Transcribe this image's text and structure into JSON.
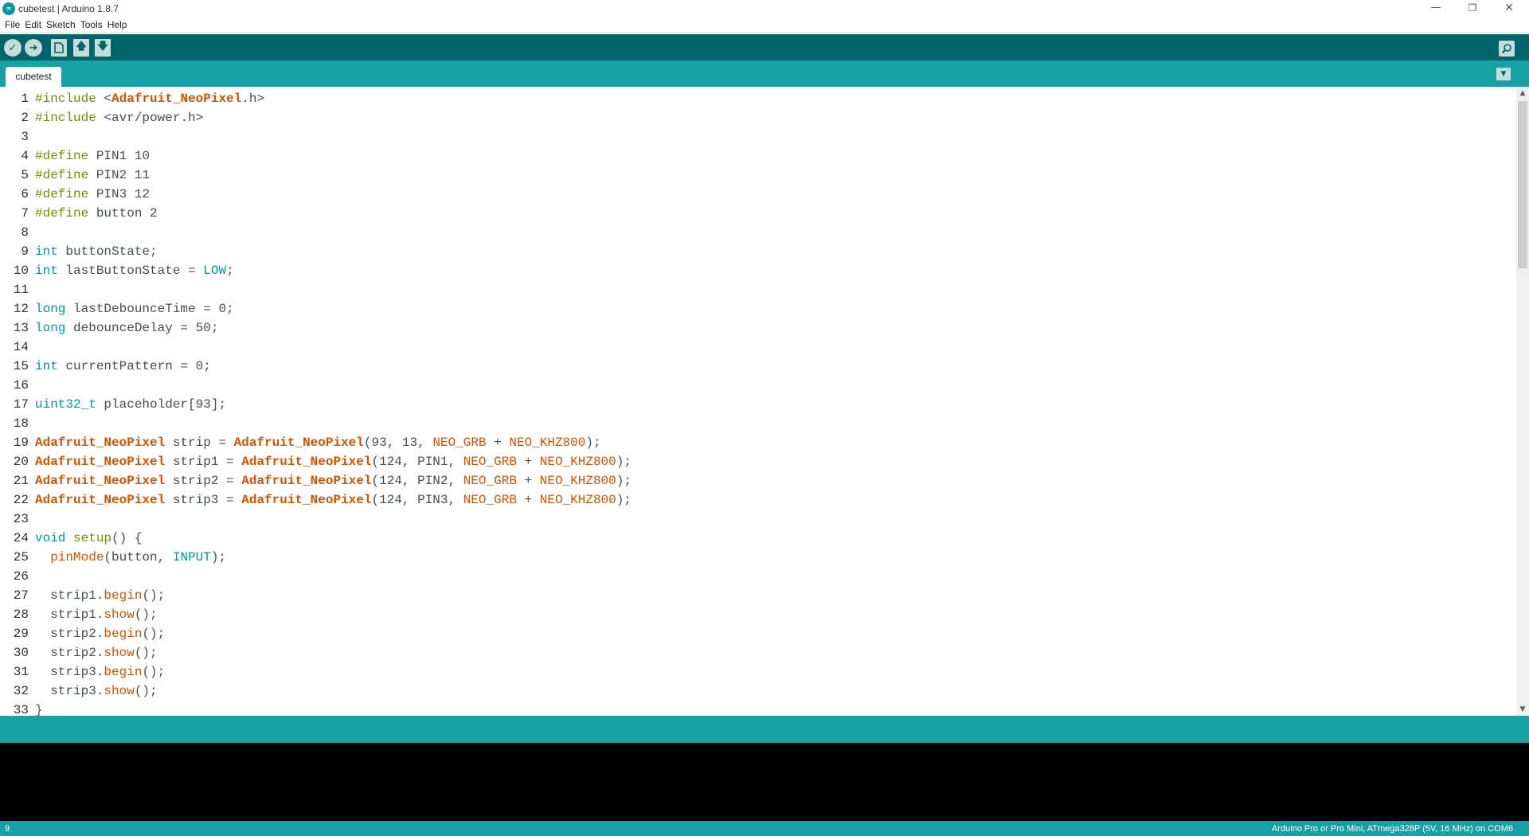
{
  "window": {
    "title": "cubetest | Arduino 1.8.7",
    "logo_text": "∞",
    "minimize": "—",
    "maximize": "❐",
    "close": "✕"
  },
  "menu": [
    "File",
    "Edit",
    "Sketch",
    "Tools",
    "Help"
  ],
  "toolbar": {
    "verify_icon": "check-icon",
    "upload_icon": "arrow-right-icon",
    "new_icon": "new-file-icon",
    "open_icon": "arrow-up-icon",
    "save_icon": "arrow-down-icon",
    "serial_monitor_icon": "magnifier-icon"
  },
  "tab": {
    "label": "cubetest",
    "menu_icon": "triangle-down-icon"
  },
  "code_lines": [
    [
      [
        "#include ",
        "kw"
      ],
      [
        "<",
        ""
      ],
      [
        "Adafruit_NeoPixel",
        "lib"
      ],
      [
        ".h>",
        ""
      ]
    ],
    [
      [
        "#include ",
        "kw"
      ],
      [
        "<avr/power.h>",
        ""
      ]
    ],
    [],
    [
      [
        "#define ",
        "kw"
      ],
      [
        "PIN1 10",
        ""
      ]
    ],
    [
      [
        "#define ",
        "kw"
      ],
      [
        "PIN2 11",
        ""
      ]
    ],
    [
      [
        "#define ",
        "kw"
      ],
      [
        "PIN3 12",
        ""
      ]
    ],
    [
      [
        "#define ",
        "kw"
      ],
      [
        "button 2",
        ""
      ]
    ],
    [],
    [
      [
        "int",
        "type"
      ],
      [
        " buttonState;",
        ""
      ]
    ],
    [
      [
        "int",
        "type"
      ],
      [
        " lastButtonState = ",
        ""
      ],
      [
        "LOW",
        "const"
      ],
      [
        ";",
        ""
      ]
    ],
    [],
    [
      [
        "long",
        "type"
      ],
      [
        " lastDebounceTime = 0;",
        ""
      ]
    ],
    [
      [
        "long",
        "type"
      ],
      [
        " debounceDelay = 50;",
        ""
      ]
    ],
    [],
    [
      [
        "int",
        "type"
      ],
      [
        " currentPattern = 0;",
        ""
      ]
    ],
    [],
    [
      [
        "uint32_t",
        "type"
      ],
      [
        " placeholder[93];",
        ""
      ]
    ],
    [],
    [
      [
        "Adafruit_NeoPixel",
        "lib"
      ],
      [
        " strip = ",
        ""
      ],
      [
        "Adafruit_NeoPixel",
        "lib"
      ],
      [
        "(93, 13, ",
        ""
      ],
      [
        "NEO_GRB",
        "neo"
      ],
      [
        " + ",
        ""
      ],
      [
        "NEO_KHZ800",
        "neo"
      ],
      [
        ");",
        ""
      ]
    ],
    [
      [
        "Adafruit_NeoPixel",
        "lib"
      ],
      [
        " strip1 = ",
        ""
      ],
      [
        "Adafruit_NeoPixel",
        "lib"
      ],
      [
        "(124, PIN1, ",
        ""
      ],
      [
        "NEO_GRB",
        "neo"
      ],
      [
        " + ",
        ""
      ],
      [
        "NEO_KHZ800",
        "neo"
      ],
      [
        ");",
        ""
      ]
    ],
    [
      [
        "Adafruit_NeoPixel",
        "lib"
      ],
      [
        " strip2 = ",
        ""
      ],
      [
        "Adafruit_NeoPixel",
        "lib"
      ],
      [
        "(124, PIN2, ",
        ""
      ],
      [
        "NEO_GRB",
        "neo"
      ],
      [
        " + ",
        ""
      ],
      [
        "NEO_KHZ800",
        "neo"
      ],
      [
        ");",
        ""
      ]
    ],
    [
      [
        "Adafruit_NeoPixel",
        "lib"
      ],
      [
        " strip3 = ",
        ""
      ],
      [
        "Adafruit_NeoPixel",
        "lib"
      ],
      [
        "(124, PIN3, ",
        ""
      ],
      [
        "NEO_GRB",
        "neo"
      ],
      [
        " + ",
        ""
      ],
      [
        "NEO_KHZ800",
        "neo"
      ],
      [
        ");",
        ""
      ]
    ],
    [],
    [
      [
        "void",
        "type"
      ],
      [
        " ",
        ""
      ],
      [
        "setup",
        "kw"
      ],
      [
        "() {",
        ""
      ]
    ],
    [
      [
        "  ",
        ""
      ],
      [
        "pinMode",
        "fn"
      ],
      [
        "(button, ",
        ""
      ],
      [
        "INPUT",
        "const"
      ],
      [
        ");",
        ""
      ]
    ],
    [],
    [
      [
        "  strip1.",
        ""
      ],
      [
        "begin",
        "fn"
      ],
      [
        "();",
        ""
      ]
    ],
    [
      [
        "  strip1.",
        ""
      ],
      [
        "show",
        "fn"
      ],
      [
        "();",
        ""
      ]
    ],
    [
      [
        "  strip2.",
        ""
      ],
      [
        "begin",
        "fn"
      ],
      [
        "();",
        ""
      ]
    ],
    [
      [
        "  strip2.",
        ""
      ],
      [
        "show",
        "fn"
      ],
      [
        "();",
        ""
      ]
    ],
    [
      [
        "  strip3.",
        ""
      ],
      [
        "begin",
        "fn"
      ],
      [
        "();",
        ""
      ]
    ],
    [
      [
        "  strip3.",
        ""
      ],
      [
        "show",
        "fn"
      ],
      [
        "();",
        ""
      ]
    ],
    [
      [
        "}",
        ""
      ]
    ]
  ],
  "scrollbar": {
    "up": "▲",
    "down": "▼"
  },
  "status": {
    "line_number": "9",
    "board": "Arduino Pro or Pro Mini, ATmega328P (5V, 16 MHz) on COM6"
  },
  "colors": {
    "toolbar": "#006468",
    "tabstrip": "#17a1a5",
    "keyword": "#728e00",
    "type": "#00979c",
    "library": "#d35400"
  }
}
